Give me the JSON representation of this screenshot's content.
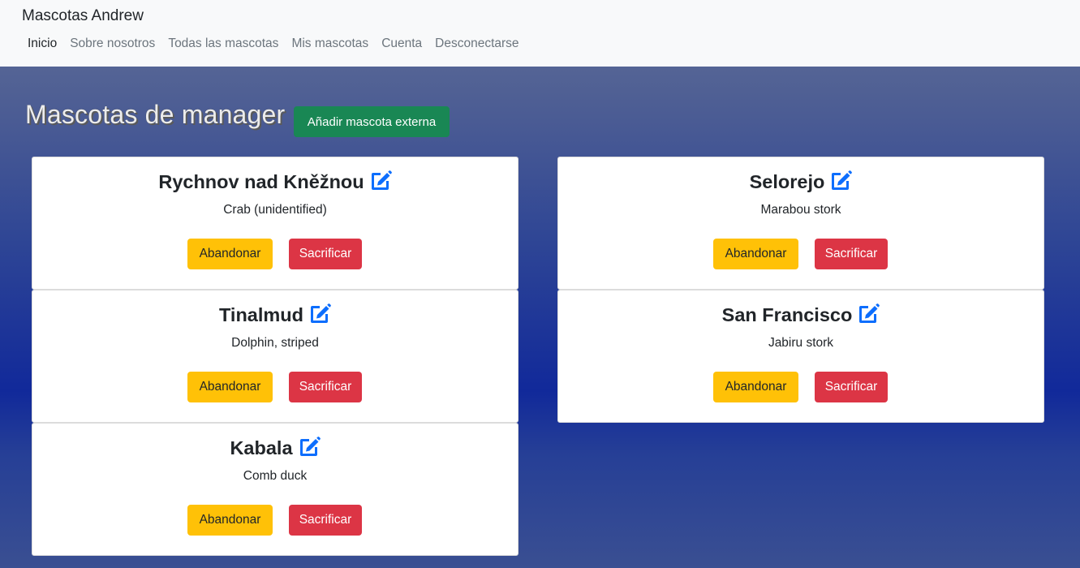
{
  "navbar": {
    "brand": "Mascotas Andrew",
    "links": [
      "Inicio",
      "Sobre nosotros",
      "Todas las mascotas",
      "Mis mascotas",
      "Cuenta",
      "Desconectarse"
    ]
  },
  "main": {
    "heading": "Mascotas de manager",
    "add_button": "Añadir mascota externa"
  },
  "actions": {
    "abandon": "Abandonar",
    "sacrifice": "Sacrificar"
  },
  "pets": [
    {
      "name": "Rychnov nad Kněžnou",
      "species": "Crab (unidentified)"
    },
    {
      "name": "Selorejo",
      "species": "Marabou stork"
    },
    {
      "name": "Tinalmud",
      "species": "Dolphin, striped"
    },
    {
      "name": "San Francisco",
      "species": "Jabiru stork"
    },
    {
      "name": "Kabala",
      "species": "Comb duck"
    }
  ],
  "colors": {
    "navbar_bg": "#f8f9fa",
    "add_button": "#198754",
    "abandon_button": "#ffc107",
    "sacrifice_button": "#dc3545",
    "edit_icon": "#0d6efd"
  }
}
